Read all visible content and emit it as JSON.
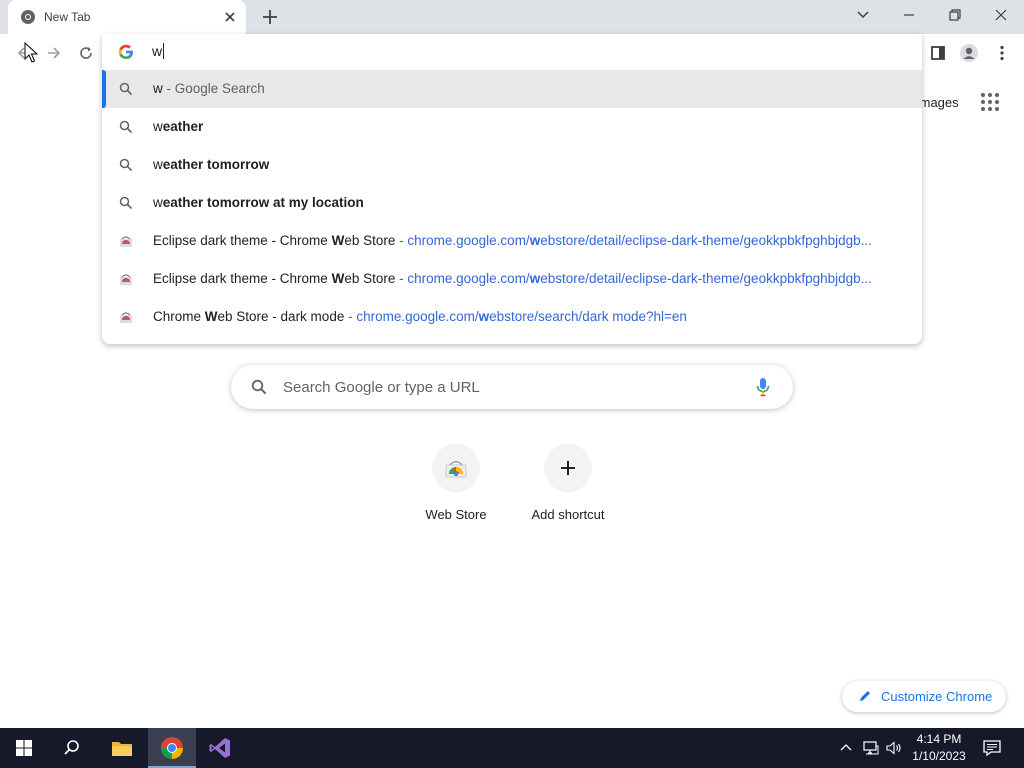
{
  "tab": {
    "title": "New Tab"
  },
  "omnibox": {
    "input_value": "w",
    "suggestions": [
      {
        "type": "search",
        "typed": "w",
        "rest": "",
        "desc": " - Google Search"
      },
      {
        "type": "search",
        "typed": "w",
        "rest": "eather"
      },
      {
        "type": "search",
        "typed": "w",
        "rest": "eather tomorrow"
      },
      {
        "type": "search",
        "typed": "w",
        "rest": "eather tomorrow at my location"
      },
      {
        "type": "history",
        "title_a": "Eclipse dark theme - Chrome ",
        "title_b": "W",
        "title_c": "eb Store",
        "sep": " - ",
        "url_a": "chrome.google.com/",
        "url_b": "w",
        "url_c": "ebstore/detail/eclipse-dark-theme/geokkpbkfpghbjdgb..."
      },
      {
        "type": "history",
        "title_a": "Eclipse dark theme - Chrome ",
        "title_b": "W",
        "title_c": "eb Store",
        "sep": " - ",
        "url_a": "chrome.google.com/",
        "url_b": "w",
        "url_c": "ebstore/detail/eclipse-dark-theme/geokkpbkfpghbjdgb..."
      },
      {
        "type": "history",
        "title_a": "Chrome ",
        "title_b": "W",
        "title_c": "eb Store - dark mode",
        "sep": " - ",
        "url_a": "chrome.google.com/",
        "url_b": "w",
        "url_c": "ebstore/search/dark mode?hl=en"
      }
    ]
  },
  "ntp": {
    "images_link": "Images",
    "search_placeholder": "Search Google or type a URL",
    "shortcuts": [
      {
        "label": "Web Store"
      },
      {
        "label": "Add shortcut"
      }
    ],
    "customize_label": "Customize Chrome"
  },
  "taskbar": {
    "time": "4:14 PM",
    "date": "1/10/2023"
  },
  "colors": {
    "accent": "#1a73e8",
    "taskbar": "#15192a",
    "tabstrip": "#dee1e6"
  }
}
